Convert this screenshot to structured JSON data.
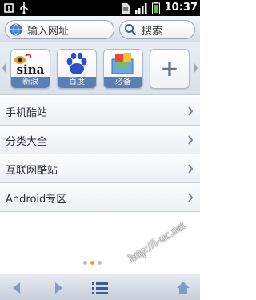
{
  "status_bar": {
    "time": "10:37",
    "left_icons": [
      "phone-alert-icon",
      "usb-icon"
    ],
    "right_icons": [
      "sim-icon",
      "signal-icon",
      "battery-icon"
    ]
  },
  "address_bar": {
    "url_placeholder": "输入网址",
    "search_placeholder": "搜索"
  },
  "quick_links": [
    {
      "label": "新浪",
      "logo_text": "sina",
      "icon": "sina-logo-icon"
    },
    {
      "label": "百度",
      "logo_text": "",
      "icon": "baidu-paw-icon"
    },
    {
      "label": "必备",
      "logo_text": "",
      "icon": "essentials-box-icon"
    }
  ],
  "add_tile": {
    "symbol": "+"
  },
  "nav_list": [
    {
      "label": "手机酷站"
    },
    {
      "label": "分类大全"
    },
    {
      "label": "互联网酷站"
    },
    {
      "label": "Android专区"
    }
  ],
  "pager": {
    "pages": 3,
    "active": 1
  },
  "toolbar": {
    "buttons": [
      "back-icon",
      "forward-icon",
      "menu-icon",
      "home-icon"
    ]
  },
  "watermark": "http://i-uc.net",
  "colors": {
    "accent_blue": "#5b7fb5",
    "status_bar": "#000000",
    "active_dot": "#f0a020"
  }
}
